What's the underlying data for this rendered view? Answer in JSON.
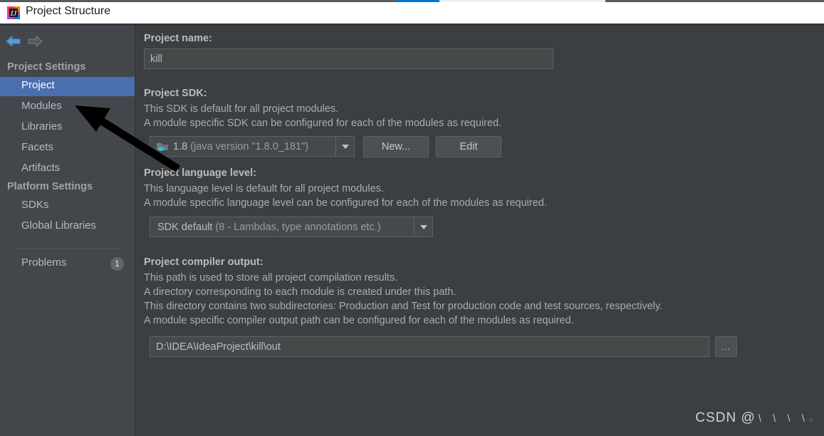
{
  "window": {
    "title": "Project Structure",
    "app_icon": "intellij-idea-logo-icon"
  },
  "toolbar": {
    "back_icon": "arrow-left-icon",
    "forward_icon": "arrow-right-icon"
  },
  "sidebar": {
    "groups": [
      {
        "label": "Project Settings"
      },
      {
        "label": "Platform Settings"
      }
    ],
    "items": [
      {
        "label": "Project",
        "selected": true
      },
      {
        "label": "Modules",
        "selected": false
      },
      {
        "label": "Libraries",
        "selected": false
      },
      {
        "label": "Facets",
        "selected": false
      },
      {
        "label": "Artifacts",
        "selected": false
      },
      {
        "label": "SDKs",
        "selected": false
      },
      {
        "label": "Global Libraries",
        "selected": false
      }
    ],
    "problems": {
      "label": "Problems",
      "badge": "1"
    }
  },
  "main": {
    "project_name": {
      "label": "Project name:",
      "value": "kill"
    },
    "project_sdk": {
      "label": "Project SDK:",
      "desc1": "This SDK is default for all project modules.",
      "desc2": "A module specific SDK can be configured for each of the modules as required.",
      "selected_name": "1.8",
      "selected_detail": "(java version \"1.8.0_181\")",
      "icon": "java-sdk-folder-icon",
      "new_button": "New...",
      "edit_button": "Edit"
    },
    "language_level": {
      "label": "Project language level:",
      "desc1": "This language level is default for all project modules.",
      "desc2": "A module specific language level can be configured for each of the modules as required.",
      "selected_name": "SDK default",
      "selected_detail": "(8 - Lambdas, type annotations etc.)"
    },
    "compiler_output": {
      "label": "Project compiler output:",
      "desc1": "This path is used to store all project compilation results.",
      "desc2": "A directory corresponding to each module is created under this path.",
      "desc3": "This directory contains two subdirectories: Production and Test for production code and test sources, respectively.",
      "desc4": "A module specific compiler output path can be configured for each of the modules as required.",
      "value": "D:\\IDEA\\IdeaProject\\kill\\out",
      "browse_button": "..."
    }
  },
  "annotation": {
    "arrow": "black-arrow-pointing-to-modules"
  },
  "watermark": {
    "text": "CSDN @",
    "obscured": "\\ \\ \\ \\",
    "trailing": "○"
  },
  "colors": {
    "accent_blue": "#4b6eaf",
    "titlebar_blue": "#0078d7",
    "panel_bg": "#3c3f41",
    "sidebar_bg": "#43474c",
    "field_bg": "#45494a"
  }
}
